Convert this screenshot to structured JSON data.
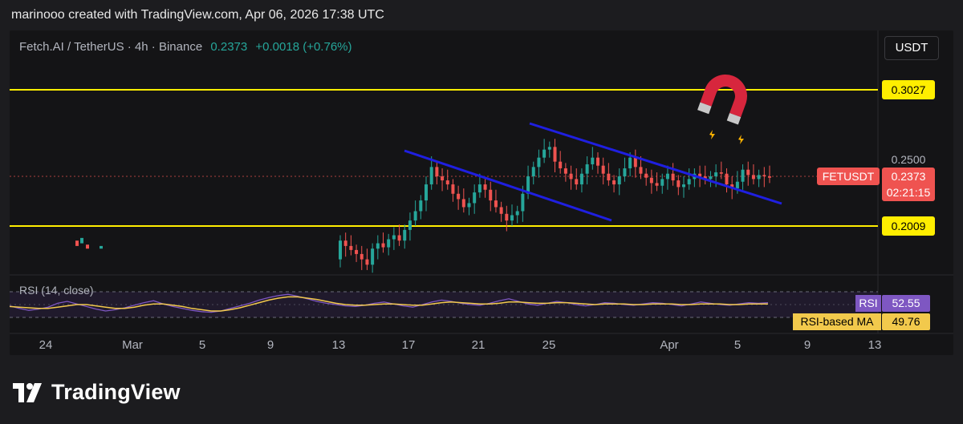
{
  "header": "marinooo created with TradingView.com, Apr 06, 2026 17:38 UTC",
  "symbol": {
    "name": "Fetch.AI / TetherUS · 4h · Binance",
    "price": "0.2373",
    "change": "+0.0018 (+0.76%)"
  },
  "currency_button": "USDT",
  "price_labels": {
    "upper_line": "0.3027",
    "tick_0250": "0.2500",
    "last_price": "0.2373",
    "ticker": "FETUSDT",
    "countdown": "02:21:15",
    "lower_line": "0.2009"
  },
  "rsi": {
    "title": "RSI (14, close)",
    "rsi_label": "RSI",
    "rsi_value": "52.55",
    "ma_label": "RSI-based MA",
    "ma_value": "49.76"
  },
  "x_ticks": [
    "24",
    "Mar",
    "5",
    "9",
    "13",
    "17",
    "21",
    "25",
    "Apr",
    "5",
    "9",
    "13"
  ],
  "footer_brand": "TradingView",
  "colors": {
    "up": "#26a69a",
    "down": "#ef5350",
    "level_line": "#ffee00",
    "trend_line": "#1f1fe0",
    "rsi_line": "#7e57c2",
    "rsi_ma": "#f2c94c"
  },
  "chart_data": {
    "type": "candlestick",
    "timeframe": "4h",
    "x_start": "Feb 26",
    "x_end": "Apr 6",
    "points_per_day": 6,
    "horizontal_levels": [
      0.3027,
      0.2009
    ],
    "last_price": 0.2373,
    "close": [
      0.19,
      0.186,
      0.183,
      0.18,
      0.176,
      0.172,
      0.184,
      0.188,
      0.185,
      0.191,
      0.194,
      0.19,
      0.198,
      0.205,
      0.212,
      0.22,
      0.232,
      0.245,
      0.238,
      0.235,
      0.232,
      0.225,
      0.221,
      0.215,
      0.218,
      0.226,
      0.232,
      0.228,
      0.22,
      0.215,
      0.21,
      0.205,
      0.209,
      0.212,
      0.225,
      0.238,
      0.245,
      0.252,
      0.258,
      0.26,
      0.249,
      0.244,
      0.24,
      0.236,
      0.232,
      0.24,
      0.247,
      0.252,
      0.246,
      0.24,
      0.235,
      0.232,
      0.238,
      0.244,
      0.252,
      0.245,
      0.24,
      0.237,
      0.233,
      0.231,
      0.236,
      0.24,
      0.235,
      0.23,
      0.232,
      0.236,
      0.24,
      0.238,
      0.236,
      0.238,
      0.241,
      0.24,
      0.232,
      0.229,
      0.234,
      0.243,
      0.239,
      0.236,
      0.239,
      0.238,
      0.237
    ],
    "rsi": [
      48,
      44,
      41,
      43,
      46,
      52,
      55,
      51,
      47,
      43,
      40,
      42,
      45,
      49,
      53,
      56,
      51,
      47,
      44,
      41,
      39,
      38,
      40,
      44,
      48,
      52,
      57,
      61,
      64,
      66,
      63,
      59,
      55,
      52,
      50,
      48,
      47,
      49,
      52,
      54,
      51,
      48,
      46,
      50,
      54,
      57,
      55,
      52,
      50,
      49,
      52,
      56,
      59,
      55,
      51,
      49,
      52,
      55,
      53,
      50,
      48,
      50,
      53,
      52,
      50,
      49,
      51,
      53,
      52,
      50,
      48,
      51,
      54,
      52,
      50,
      49,
      51,
      53,
      52,
      53
    ],
    "rsi_ma": [
      47,
      46,
      45,
      44,
      44,
      46,
      48,
      50,
      50,
      48,
      46,
      44,
      44,
      46,
      49,
      51,
      51,
      49,
      47,
      44,
      42,
      40,
      40,
      42,
      45,
      49,
      53,
      57,
      60,
      62,
      62,
      60,
      58,
      55,
      52,
      50,
      49,
      49,
      50,
      51,
      51,
      50,
      49,
      49,
      51,
      53,
      54,
      53,
      52,
      51,
      51,
      52,
      54,
      54,
      53,
      52,
      52,
      53,
      53,
      52,
      51,
      50,
      51,
      51,
      51,
      50,
      50,
      51,
      51,
      51,
      50,
      50,
      51,
      51,
      51,
      50,
      50,
      51,
      51,
      51
    ]
  }
}
